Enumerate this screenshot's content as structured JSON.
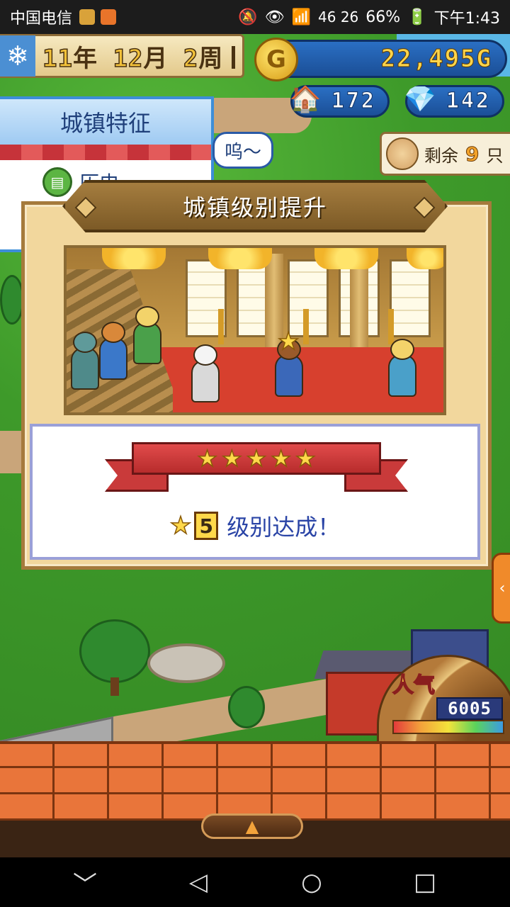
{
  "status_bar": {
    "carrier": "中国电信",
    "network": "46 26",
    "battery": "66%",
    "time": "下午1:43",
    "icons": [
      "notification-app-icon",
      "video-app-icon",
      "mute-icon",
      "eye-icon",
      "wifi-icon",
      "signal-icon",
      "battery-icon"
    ]
  },
  "hud": {
    "date": {
      "year": "11",
      "year_unit": "年",
      "month": "12",
      "month_unit": "月",
      "week": "2",
      "week_unit": "周"
    },
    "season_icon": "snowflake-icon",
    "gold": {
      "icon_letter": "G",
      "value": "22,495G"
    },
    "town_count": "172",
    "crystal_count": "142",
    "remaining": {
      "prefix": "剩余",
      "count": "9",
      "suffix": "只"
    }
  },
  "feature_panel": {
    "title": "城镇特征",
    "item_label": "历史"
  },
  "speech_bubble": "呜～",
  "popup": {
    "title": "城镇级别提升",
    "stars": [
      "★",
      "★",
      "★",
      "★",
      "★"
    ],
    "achievement_star": "★",
    "level": "5",
    "achievement_text": "级别达成！"
  },
  "popularity": {
    "label": "人气",
    "value": "6005"
  },
  "footer": {
    "expand_arrow": "▲"
  },
  "nav": {
    "back": "◁",
    "home": "○",
    "recents": "□",
    "hide": "﹀"
  },
  "colors": {
    "hud_blue": "#1b4f97",
    "gold": "#ffd54a",
    "popup_bg": "#f2d79d",
    "ribbon_red": "#c93a3a",
    "achievement_text": "#2a44a6",
    "brick": "#e9753a"
  }
}
